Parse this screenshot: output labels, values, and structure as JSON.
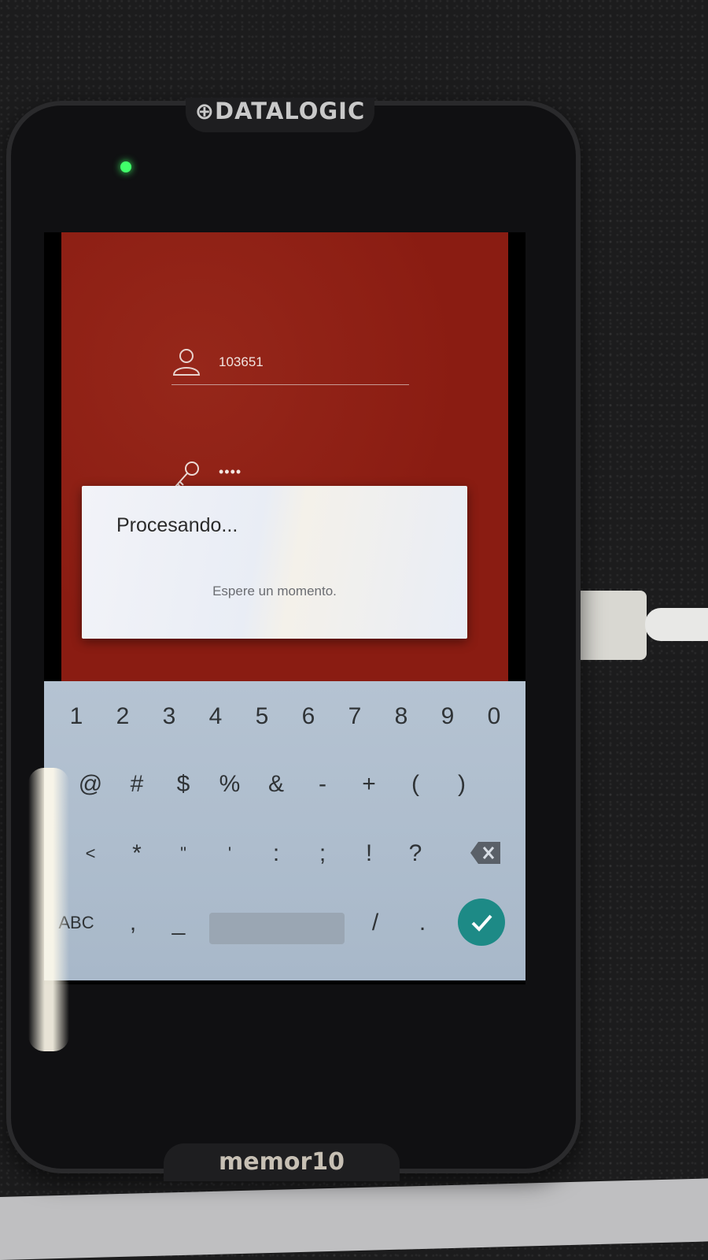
{
  "device": {
    "brand_top": "⊕DATALOGIC",
    "brand_bottom": "memor10"
  },
  "login": {
    "user_icon": "user-icon",
    "username_value": "103651",
    "password_icon": "key-icon",
    "password_value": "••••"
  },
  "dialog": {
    "title": "Procesando...",
    "message": "Espere un momento."
  },
  "keyboard": {
    "row1": [
      "1",
      "2",
      "3",
      "4",
      "5",
      "6",
      "7",
      "8",
      "9",
      "0"
    ],
    "row2": [
      "@",
      "#",
      "$",
      "%",
      "&",
      "-",
      "+",
      "(",
      ")"
    ],
    "row3": [
      "<",
      "*",
      "\"",
      "'",
      ":",
      ";",
      "!",
      "?"
    ],
    "row4": {
      "abc_label": "ABC",
      "comma": ",",
      "underscore": "_",
      "slash": "/",
      "period": "."
    },
    "backspace_icon": "backspace-icon",
    "enter_icon": "check-icon"
  },
  "navbar": {
    "back_icon": "back-icon",
    "home_icon": "home-icon",
    "recents_icon": "recents-icon"
  },
  "colors": {
    "app_background": "#8a1c12",
    "dialog_background": "#eef1f7",
    "keyboard_background": "#aebccb",
    "enter_key": "#1d8a86",
    "led": "#41ff6a"
  }
}
